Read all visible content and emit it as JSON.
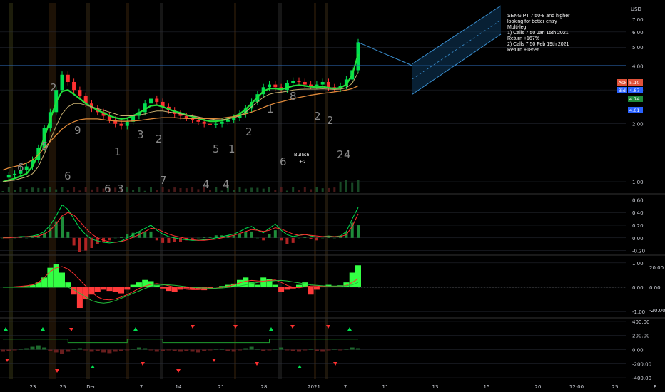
{
  "currency": "USD",
  "note_lines": [
    "SENG PT 7.50-8 and higher",
    "looking for better entry",
    "Multi-leg:",
    "1) Calls 7.50 Jan 15th 2021",
    "Return +167%",
    "2) Calls 7.50 Feb 19th 2021",
    "Return +185%"
  ],
  "price_tags": [
    {
      "label": "Ask",
      "value": "5.10",
      "color": "#e0523a"
    },
    {
      "label": "Bid",
      "value": "4.87",
      "color": "#2962ff"
    },
    {
      "label": "",
      "value": "4.74",
      "color": "#1e8c3a"
    },
    {
      "label": "",
      "value": "4.01",
      "color": "#2962ff"
    }
  ],
  "bullish_label": {
    "text": "Bullish",
    "sub": "+2"
  },
  "colors": {
    "up": "#00e050",
    "down": "#ff3030",
    "ma_green": "#22e03a",
    "ma_orange": "#e08a3a",
    "ma_tan": "#c8b070",
    "channel": "#3a8fd0",
    "hline": "#2f6fc0",
    "grid": "#2a2e39"
  },
  "chart_data": [
    {
      "type": "line",
      "panel": "price",
      "x_ticks": [
        "23",
        "25",
        "Dec",
        "7",
        "14",
        "21",
        "28",
        "2021",
        "7",
        "11",
        "13",
        "15",
        "20",
        "12:00",
        "25",
        "F"
      ],
      "y_ticks": [
        1.0,
        2.0,
        3.0,
        4.0,
        5.0,
        6.0,
        7.0
      ],
      "ylim": [
        0.88,
        8.5
      ],
      "log_scale": true,
      "horizontal_line": 4.01,
      "series": [
        {
          "values": [
            1.05,
            1.08,
            1.1,
            1.15,
            1.2,
            1.3,
            1.5,
            1.9,
            2.3,
            3.0,
            3.6,
            3.3,
            3.0,
            2.8,
            2.55,
            2.4,
            2.3,
            2.2,
            2.1,
            2.0,
            1.95,
            2.05,
            2.2,
            2.3,
            2.55,
            2.7,
            2.6,
            2.45,
            2.35,
            2.25,
            2.2,
            2.15,
            2.1,
            2.05,
            2.0,
            1.98,
            2.0,
            2.05,
            2.1,
            2.15,
            2.25,
            2.4,
            2.6,
            2.85,
            3.1,
            3.2,
            3.1,
            3.0,
            3.25,
            3.35,
            3.3,
            3.2,
            3.15,
            3.2,
            3.3,
            3.1,
            3.05,
            3.15,
            3.4,
            3.8,
            5.3
          ]
        },
        {
          "values": [
            1.0,
            1.02,
            1.04,
            1.07,
            1.1,
            1.2,
            1.4,
            1.7,
            2.1,
            2.6,
            2.95,
            3.0,
            2.85,
            2.7,
            2.55,
            2.45,
            2.35,
            2.28,
            2.2,
            2.15,
            2.12,
            2.14,
            2.2,
            2.28,
            2.38,
            2.48,
            2.5,
            2.45,
            2.38,
            2.32,
            2.28,
            2.22,
            2.18,
            2.13,
            2.09,
            2.06,
            2.06,
            2.08,
            2.12,
            2.18,
            2.25,
            2.38,
            2.55,
            2.75,
            2.95,
            3.05,
            3.05,
            3.02,
            3.08,
            3.15,
            3.18,
            3.15,
            3.12,
            3.1,
            3.12,
            3.08,
            3.05,
            3.08,
            3.2,
            3.6,
            4.6
          ]
        },
        {
          "values": [
            1.0,
            1.01,
            1.02,
            1.04,
            1.06,
            1.1,
            1.2,
            1.4,
            1.65,
            1.95,
            2.25,
            2.45,
            2.55,
            2.55,
            2.5,
            2.45,
            2.4,
            2.35,
            2.3,
            2.25,
            2.2,
            2.2,
            2.2,
            2.22,
            2.25,
            2.3,
            2.33,
            2.33,
            2.3,
            2.28,
            2.25,
            2.22,
            2.2,
            2.17,
            2.14,
            2.12,
            2.1,
            2.1,
            2.12,
            2.15,
            2.2,
            2.3,
            2.45,
            2.6,
            2.75,
            2.85,
            2.9,
            2.92,
            2.95,
            3.0,
            3.02,
            3.03,
            3.03,
            3.03,
            3.04,
            3.03,
            3.02,
            3.03,
            3.08,
            3.25,
            3.7
          ]
        },
        {
          "values": [
            1.15,
            1.18,
            1.2,
            1.22,
            1.25,
            1.3,
            1.38,
            1.5,
            1.62,
            1.75,
            1.88,
            1.98,
            2.05,
            2.1,
            2.12,
            2.12,
            2.12,
            2.1,
            2.08,
            2.07,
            2.06,
            2.06,
            2.07,
            2.08,
            2.1,
            2.12,
            2.14,
            2.15,
            2.15,
            2.15,
            2.14,
            2.13,
            2.13,
            2.13,
            2.13,
            2.13,
            2.13,
            2.14,
            2.16,
            2.18,
            2.21,
            2.25,
            2.3,
            2.36,
            2.43,
            2.5,
            2.56,
            2.6,
            2.65,
            2.7,
            2.74,
            2.78,
            2.82,
            2.85,
            2.88,
            2.9,
            2.93,
            2.96,
            3.0,
            3.05,
            3.15
          ]
        }
      ],
      "annotation_counts": [
        "2",
        "5",
        "6",
        "9",
        "6",
        "3",
        "6",
        "1",
        "3",
        "2",
        "7",
        "4",
        "4",
        "5",
        "1",
        "2",
        "1",
        "6",
        "8",
        "2",
        "2",
        "2",
        "4"
      ]
    },
    {
      "type": "area",
      "panel": "oscillator_1",
      "y_ticks": [
        -0.2,
        0.0,
        0.2,
        0.4,
        0.6
      ],
      "ylim": [
        -0.25,
        0.65
      ],
      "series": [
        {
          "values": [
            0,
            0.01,
            0.01,
            0.02,
            0.02,
            0.03,
            0.05,
            0.1,
            0.2,
            0.35,
            0.52,
            0.45,
            0.3,
            0.15,
            0.05,
            -0.02,
            -0.05,
            -0.07,
            -0.08,
            -0.07,
            -0.05,
            0,
            0.05,
            0.1,
            0.15,
            0.2,
            0.12,
            0.06,
            0.02,
            0,
            -0.02,
            -0.03,
            -0.04,
            -0.04,
            -0.03,
            -0.02,
            0,
            0.02,
            0.04,
            0.06,
            0.1,
            0.15,
            0.18,
            0.12,
            0.08,
            0.15,
            0.22,
            0.12,
            0.05,
            0.02,
            0.04,
            0.06,
            0.03,
            0.01,
            0.02,
            0.03,
            0.02,
            0.03,
            0.1,
            0.3,
            0.48
          ]
        },
        {
          "values": [
            0,
            0,
            0.01,
            0.01,
            0.02,
            0.02,
            0.03,
            0.06,
            0.12,
            0.22,
            0.35,
            0.4,
            0.36,
            0.26,
            0.15,
            0.06,
            0,
            -0.04,
            -0.06,
            -0.07,
            -0.06,
            -0.03,
            0.01,
            0.05,
            0.1,
            0.15,
            0.14,
            0.1,
            0.06,
            0.03,
            0.01,
            -0.01,
            -0.03,
            -0.04,
            -0.04,
            -0.03,
            -0.02,
            0,
            0.02,
            0.04,
            0.07,
            0.1,
            0.13,
            0.12,
            0.1,
            0.12,
            0.16,
            0.14,
            0.1,
            0.06,
            0.04,
            0.05,
            0.04,
            0.03,
            0.02,
            0.02,
            0.02,
            0.02,
            0.05,
            0.18,
            0.38
          ]
        }
      ]
    },
    {
      "type": "bar",
      "panel": "oscillator_2",
      "y_ticks_left": [
        -1.0,
        0.0,
        1.0
      ],
      "y_ticks_right": [
        -20.0,
        0.0,
        20.0
      ],
      "ylim": [
        -1.2,
        1.2
      ],
      "series": [
        {
          "values": [
            0.02,
            0.02,
            0.03,
            0.04,
            0.05,
            0.1,
            0.2,
            0.4,
            0.8,
            0.95,
            0.6,
            0.2,
            -0.3,
            -0.85,
            -0.5,
            -0.3,
            -0.2,
            -0.1,
            -0.15,
            -0.2,
            -0.25,
            -0.1,
            0.1,
            0.2,
            0.3,
            0.25,
            0.1,
            -0.05,
            -0.15,
            -0.2,
            -0.1,
            -0.05,
            -0.08,
            -0.1,
            -0.12,
            -0.05,
            0.02,
            0.05,
            0.1,
            0.15,
            0.3,
            0.4,
            0.2,
            0.1,
            0.4,
            0.35,
            0.1,
            -0.2,
            -0.1,
            -0.05,
            0.1,
            0.2,
            -0.3,
            -0.1,
            0.05,
            0.1,
            0.05,
            0.08,
            0.2,
            0.6,
            0.9
          ]
        },
        {
          "values": [
            0,
            0,
            0.02,
            0.04,
            0.06,
            0.1,
            0.2,
            0.4,
            0.65,
            0.8,
            0.85,
            0.75,
            0.55,
            0.3,
            0.05,
            -0.2,
            -0.4,
            -0.5,
            -0.52,
            -0.48,
            -0.4,
            -0.3,
            -0.18,
            -0.05,
            0.05,
            0.12,
            0.15,
            0.12,
            0.06,
            0,
            -0.05,
            -0.08,
            -0.1,
            -0.1,
            -0.08,
            -0.06,
            -0.04,
            0,
            0.04,
            0.1,
            0.18,
            0.25,
            0.28,
            0.26,
            0.25,
            0.28,
            0.3,
            0.2,
            0.08,
            0,
            -0.02,
            0.02,
            0.05,
            0.05,
            0.03,
            0.03,
            0.03,
            0.04,
            0.08,
            0.2,
            0.35
          ]
        },
        {
          "values": [
            0,
            0,
            0,
            0,
            0,
            0,
            0,
            0,
            0,
            0,
            0,
            0,
            -0.1,
            -0.25,
            -0.4,
            -0.55,
            -0.62,
            -0.65,
            -0.62,
            -0.55,
            -0.45,
            -0.35,
            -0.25,
            -0.15,
            -0.05,
            0.03,
            0.08,
            0.1,
            0.1,
            0.08,
            0.05,
            0.02,
            0,
            -0.02,
            -0.03,
            -0.04,
            -0.04,
            -0.03,
            -0.01,
            0.02,
            0.05,
            0.1,
            0.15,
            0.2,
            0.22,
            0.25,
            0.27,
            0.28,
            0.26,
            0.22,
            0.18,
            0.14,
            0.1,
            0.08,
            0.06,
            0.05,
            0.05,
            0.05,
            0.06,
            0.1,
            0.2
          ]
        }
      ]
    },
    {
      "type": "line",
      "panel": "oscillator_3",
      "y_ticks": [
        -400.0,
        -200.0,
        0.0,
        200.0,
        400.0
      ],
      "ylim": [
        -420,
        420
      ],
      "series": [
        {
          "values": [
            150,
            150,
            150,
            150,
            150,
            150,
            150,
            150,
            150,
            150,
            150,
            100,
            100,
            100,
            100,
            100,
            100,
            100,
            100,
            100,
            100,
            150,
            150,
            150,
            150,
            150,
            150,
            100,
            100,
            100,
            100,
            100,
            100,
            100,
            100,
            100,
            100,
            100,
            100,
            100,
            100,
            100,
            100,
            100,
            100,
            150,
            150,
            150,
            150,
            150,
            150,
            150,
            150,
            150,
            150,
            150,
            150,
            150,
            150,
            150,
            150
          ]
        },
        {
          "values": [
            -30,
            -20,
            -10,
            0,
            20,
            40,
            60,
            30,
            -20,
            -40,
            -60,
            -30,
            0,
            20,
            -10,
            -30,
            -20,
            -40,
            -50,
            -30,
            -20,
            -10,
            10,
            30,
            20,
            -10,
            -30,
            -20,
            -10,
            -20,
            -30,
            -20,
            -30,
            -40,
            -20,
            -10,
            0,
            10,
            -20,
            -30,
            -10,
            20,
            40,
            10,
            -20,
            -10,
            10,
            30,
            -10,
            -20,
            -30,
            -10,
            10,
            -20,
            -30,
            -10,
            0,
            -10,
            10,
            30,
            20
          ]
        }
      ]
    }
  ]
}
